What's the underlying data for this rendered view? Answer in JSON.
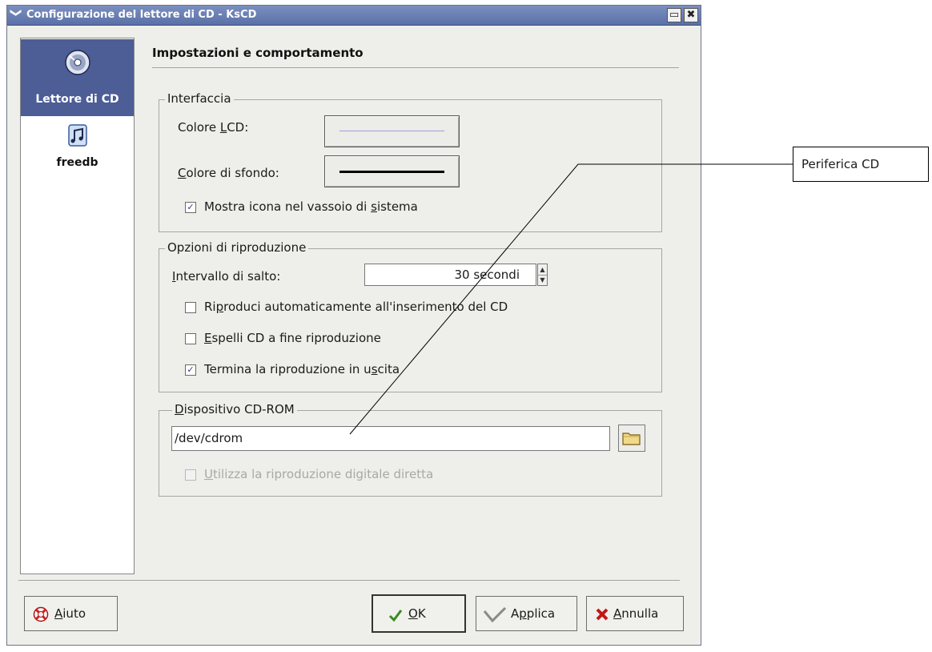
{
  "window": {
    "title": "Configurazione del lettore di CD - KsCD",
    "menu_glyph": "❯",
    "maximize_glyph": "▭",
    "close_glyph": "✖"
  },
  "sidebar": {
    "items": [
      {
        "label": "Lettore di CD",
        "icon": "cd-player-icon",
        "active": true
      },
      {
        "label": "freedb",
        "icon": "freedb-music-icon",
        "active": false
      }
    ]
  },
  "main": {
    "title": "Impostazioni e comportamento",
    "interfaccia": {
      "legend": "Interfaccia",
      "lcd_color_pre": "Colore ",
      "lcd_color_u": "L",
      "lcd_color_post": "CD:",
      "bg_color_u": "C",
      "bg_color_post": "olore di sfondo:",
      "tray_pre": "Mostra icona nel vassoio di ",
      "tray_u": "s",
      "tray_post": "istema",
      "tray_checked": "✓"
    },
    "riproduzione": {
      "legend": "Opzioni di riproduzione",
      "skip_u": "I",
      "skip_post": "ntervallo di salto:",
      "skip_value": "30 secondi",
      "spin_up": "▲",
      "spin_down": "▼",
      "autoplay_pre": "Ri",
      "autoplay_u": "p",
      "autoplay_post": "roduci automaticamente all'inserimento del CD",
      "eject_u": "E",
      "eject_post": "spelli CD a fine riproduzione",
      "stop_pre": "Termina la riproduzione in u",
      "stop_u": "s",
      "stop_post": "cita",
      "stop_checked": "✓"
    },
    "dispositivo": {
      "legend_u": "D",
      "legend_post": "ispositivo CD-ROM",
      "device_path": "/dev/cdrom",
      "digital_u": "U",
      "digital_post": "tilizza la riproduzione digitale diretta"
    }
  },
  "buttons": {
    "help_u": "A",
    "help_post": "iuto",
    "ok_u": "O",
    "ok_post": "K",
    "apply_pre": "A",
    "apply_u": "p",
    "apply_post": "plica",
    "cancel_u": "A",
    "cancel_post": "nnulla"
  },
  "callout": {
    "label": "Periferica CD"
  }
}
